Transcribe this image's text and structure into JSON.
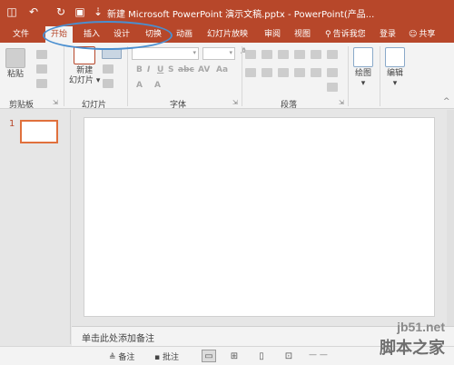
{
  "window": {
    "title": "新建 Microsoft PowerPoint 演示文稿.pptx - PowerPoint(产品..."
  },
  "quick_access": [
    {
      "icon": "save-icon",
      "glyph": "🖫"
    },
    {
      "icon": "undo-icon",
      "glyph": "↶"
    },
    {
      "icon": "redo-icon",
      "glyph": "↻"
    },
    {
      "icon": "start-slideshow-icon",
      "glyph": "⊡"
    },
    {
      "icon": "customize-icon",
      "glyph": "⇣"
    }
  ],
  "tabs": {
    "file": "文件",
    "home": "开始",
    "insert": "插入",
    "design": "设计",
    "transitions": "切换",
    "animations": "动画",
    "slideshow": "幻灯片放映",
    "review": "审阅",
    "view": "视图",
    "tell_me": "告诉我您",
    "signin": "登录",
    "share": "共享"
  },
  "ribbon": {
    "paste_label": "粘贴",
    "new_slide_label_1": "新建",
    "new_slide_label_2": "幻灯片",
    "drawing_label": "绘图",
    "editing_label": "编辑",
    "groups": {
      "clipboard": "剪贴板",
      "slides": "幻灯片",
      "font": "字体",
      "paragraph": "段落"
    },
    "font_format": [
      "B",
      "I",
      "U",
      "S",
      "abc",
      "AV",
      "Aa",
      "A",
      "A"
    ]
  },
  "thumbnails": {
    "slide_number": "1"
  },
  "notes_placeholder": "单击此处添加备注",
  "statusbar": {
    "notes": "备注",
    "comments": "批注"
  },
  "watermark": {
    "url": "jb51.net",
    "name": "脚本之家"
  },
  "colors": {
    "accent": "#b7472a",
    "highlight_ellipse": "#4a8fd0",
    "thumb_border": "#e0703c"
  }
}
